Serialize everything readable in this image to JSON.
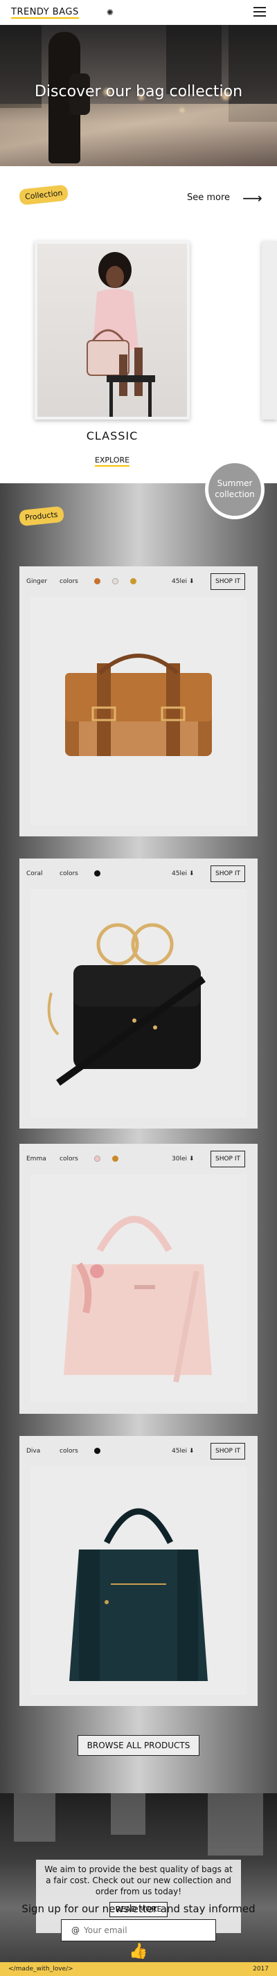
{
  "header": {
    "brand": "TRENDY BAGS",
    "menu_icon": "hamburger-icon",
    "theme_icon": "sun-icon"
  },
  "hero": {
    "title": "Discover our bag collection"
  },
  "collection": {
    "badge": "Collection",
    "see_more": "See more",
    "card": {
      "title": "CLASSIC",
      "explore": "EXPLORE"
    }
  },
  "summer_badge": "Summer collection",
  "products": {
    "badge": "Products",
    "colors_label": "colors",
    "shop_label": "SHOP IT",
    "items": [
      {
        "name": "Ginger",
        "price": "45lei",
        "price_icon": "arrow-down-icon",
        "colors": [
          "#c8712c",
          "#e8dcd6",
          "#c99a2a"
        ]
      },
      {
        "name": "Coral",
        "price": "45lei",
        "price_icon": "arrow-down-icon",
        "colors": [
          "#111111"
        ]
      },
      {
        "name": "Emma",
        "price": "30lei",
        "price_icon": "arrow-down-icon",
        "colors": [
          "#f0c7c0",
          "#c98a2a"
        ]
      },
      {
        "name": "Diva",
        "price": "45lei",
        "price_icon": "arrow-down-icon",
        "colors": [
          "#111111"
        ]
      }
    ],
    "browse": "BROWSE ALL PRODUCTS"
  },
  "about": {
    "text": "We aim to provide the best quality of bags at a fair cost. Check out our new collection and order from us today!",
    "read_more": "READ MORE"
  },
  "newsletter": {
    "title": "Sign up for our newsletter and stay informed",
    "email_placeholder": "Your email"
  },
  "footer": {
    "made": "</made_with_love/>",
    "year": "2017"
  },
  "colors": {
    "accent": "#f2c94c"
  }
}
